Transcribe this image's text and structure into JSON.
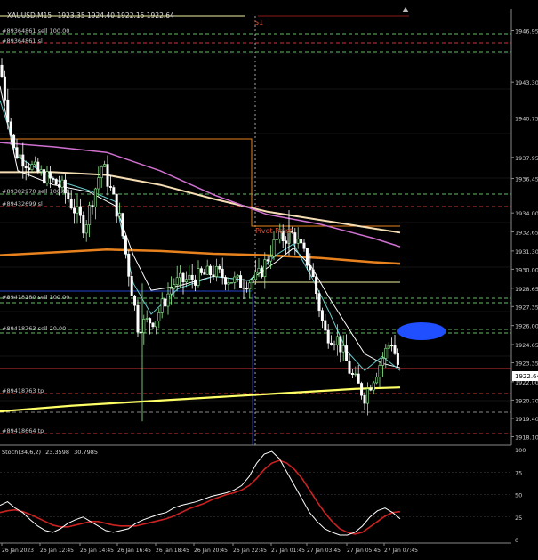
{
  "header": {
    "title": "XAUUSD,M15",
    "ohlc": "1923.35 1924.40 1922.15 1922.64"
  },
  "colors": {
    "background": "#000000",
    "grid": "#2a2a2a",
    "bull_candle": "#90ee90",
    "bear_candle": "#ffffff",
    "ma_pink": "#d070d0",
    "ma_white": "#ffffff",
    "ma_beige": "#f5deb3",
    "ma_orange": "#e8821e",
    "ma_yellow": "#ffff66",
    "ma_teal": "#66cdcd",
    "stoch_main": "#ffffff",
    "stoch_signal": "#cc2222",
    "price_marker": "#1f4fff"
  },
  "orders": [
    {
      "label": "#89364861 sell 100.00"
    },
    {
      "label": "#89364861 sl"
    },
    {
      "label": "#89382970 sell 100.00"
    },
    {
      "label": "#89432699 sl"
    },
    {
      "label": "#89418180 sell 100.00"
    },
    {
      "label": "#89418763 sell 20.00"
    },
    {
      "label": "#89418763 tp"
    },
    {
      "label": "#89418664 tp"
    }
  ],
  "annotations": {
    "pivot": "Pivot Point",
    "s1": "S1"
  },
  "price_axis": {
    "ticks": [
      "1946.95",
      "1943.30",
      "1940.75",
      "1937.95",
      "1936.45",
      "1934.00",
      "1932.65",
      "1931.30",
      "1930.00",
      "1928.65",
      "1927.35",
      "1926.00",
      "1924.65",
      "1923.35",
      "1922.00",
      "1920.70",
      "1919.40",
      "1918.10"
    ],
    "current_price": "1922.64",
    "range": [
      1917.5,
      1948.5
    ]
  },
  "time_axis": {
    "labels": [
      "26 Jan 2023",
      "26 Jan 12:45",
      "26 Jan 14:45",
      "26 Jan 16:45",
      "26 Jan 18:45",
      "26 Jan 20:45",
      "26 Jan 22:45",
      "27 Jan 01:45",
      "27 Jan 03:45",
      "27 Jan 05:45",
      "27 Jan 07:45"
    ]
  },
  "stoch": {
    "label": "Stoch(34,6,2)",
    "main_value": "23.3598",
    "signal_value": "30.7985",
    "levels": [
      "100",
      "75",
      "50",
      "25",
      "0"
    ],
    "main": [
      38,
      42,
      35,
      30,
      22,
      15,
      10,
      8,
      12,
      18,
      22,
      25,
      20,
      15,
      10,
      8,
      10,
      12,
      18,
      22,
      25,
      28,
      30,
      35,
      38,
      40,
      42,
      45,
      48,
      50,
      52,
      55,
      60,
      70,
      85,
      95,
      98,
      90,
      75,
      60,
      45,
      30,
      20,
      12,
      8,
      5,
      5,
      8,
      15,
      25,
      32,
      35,
      30,
      23
    ],
    "signal": [
      30,
      32,
      33,
      31,
      28,
      24,
      20,
      16,
      14,
      14,
      16,
      18,
      20,
      20,
      18,
      16,
      15,
      15,
      15,
      17,
      19,
      21,
      23,
      26,
      30,
      34,
      37,
      40,
      44,
      47,
      50,
      52,
      55,
      60,
      68,
      78,
      85,
      88,
      85,
      78,
      68,
      55,
      42,
      30,
      20,
      12,
      8,
      6,
      8,
      14,
      20,
      26,
      30,
      31
    ]
  },
  "chart_data": {
    "type": "line",
    "title": "XAUUSD,M15",
    "x": [
      "26 Jan 2023",
      "26 Jan 12:45",
      "26 Jan 14:45",
      "26 Jan 16:45",
      "26 Jan 18:45",
      "26 Jan 20:45",
      "26 Jan 22:45",
      "27 Jan 01:45",
      "27 Jan 03:45",
      "27 Jan 05:45",
      "27 Jan 07:45"
    ],
    "series": [
      {
        "values": [
          1944.5,
          1939.5,
          1937.0,
          1926.5,
          1929.5,
          1930.0,
          1929.0,
          1931.0,
          1925.0,
          1921.5,
          1922.6
        ]
      }
    ],
    "ylim": [
      1917.5,
      1948.5
    ]
  }
}
